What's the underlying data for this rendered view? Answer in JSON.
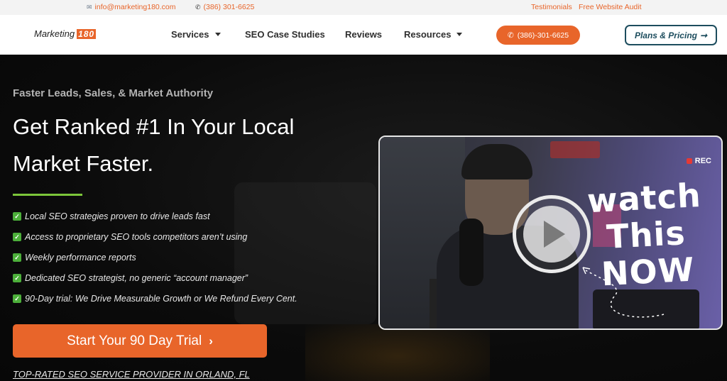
{
  "topbar": {
    "email": "info@marketing180.com",
    "phone": "(386) 301-6625",
    "links": [
      "Testimonials",
      "Free Website Audit"
    ]
  },
  "nav": {
    "logo_text": "Marketing",
    "logo_number": "180",
    "items": [
      {
        "label": "Services",
        "dropdown": true
      },
      {
        "label": "SEO Case Studies",
        "dropdown": false
      },
      {
        "label": "Reviews",
        "dropdown": false
      },
      {
        "label": "Resources",
        "dropdown": true
      }
    ],
    "phone_button": "(386)-301-6625",
    "plans_button": "Plans & Pricing"
  },
  "hero": {
    "eyebrow": "Faster Leads, Sales, & Market Authority",
    "headline": "Get Ranked #1 In Your Local Market Faster.",
    "bullets": [
      "Local SEO strategies proven to drive leads fast",
      "Access to proprietary SEO tools competitors aren’t using",
      "Weekly performance reports",
      "Dedicated SEO strategist, no generic “account manager”",
      "90-Day trial: We Drive Measurable Growth or We Refund Every Cent."
    ],
    "cta": "Start Your 90 Day Trial",
    "footnote": "TOP-RATED SEO SERVICE PROVIDER IN ORLAND, FL"
  },
  "video": {
    "rec_label": "REC",
    "overlay_lines": [
      "watch",
      "This",
      "NOW"
    ]
  },
  "colors": {
    "accent": "#e8652a",
    "nav_dark": "#1d4d5e",
    "green": "#7cc63a"
  }
}
